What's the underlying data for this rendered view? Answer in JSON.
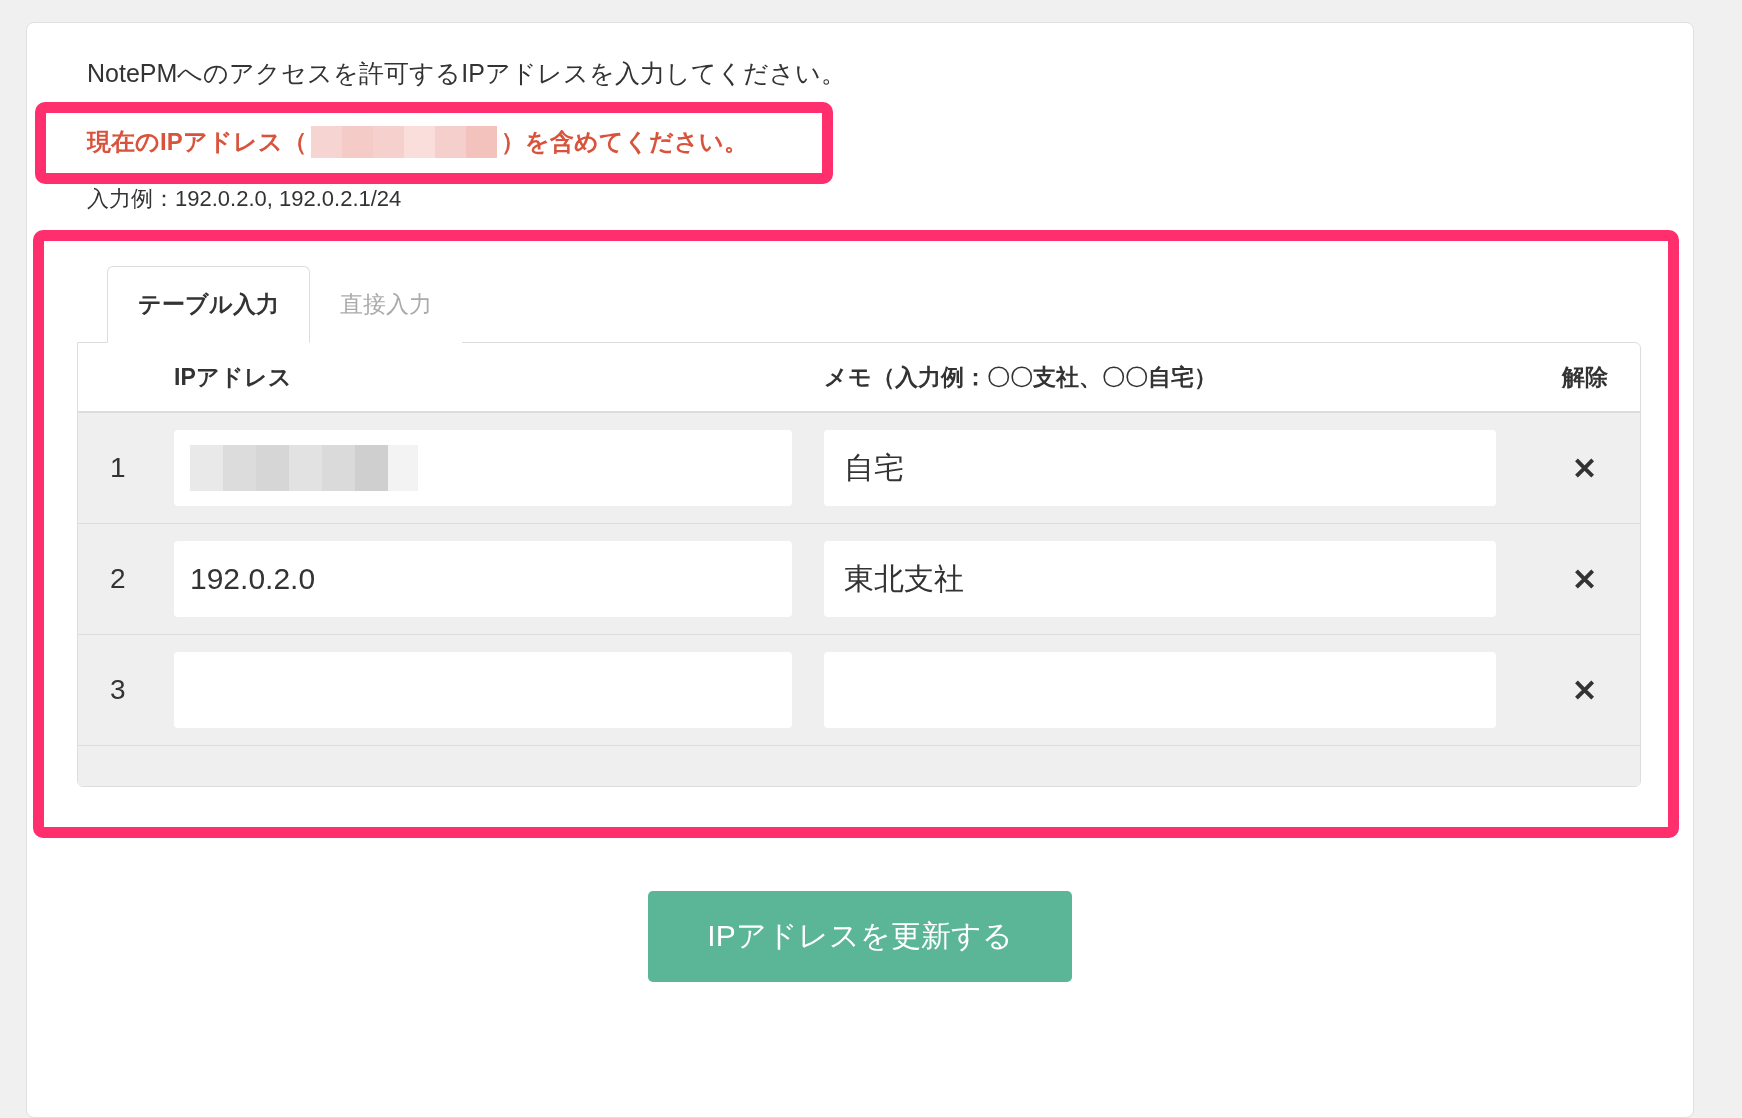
{
  "intro": "NotePMへのアクセスを許可するIPアドレスを入力してください。",
  "notice": {
    "before": "現在のIPアドレス（",
    "after": "）を含めてください。"
  },
  "example": "入力例：192.0.2.0, 192.0.2.1/24",
  "tabs": [
    {
      "label": "テーブル入力",
      "selected": true
    },
    {
      "label": "直接入力",
      "selected": false
    }
  ],
  "table": {
    "columns": [
      "IPアドレス",
      "メモ（入力例：〇〇支社、〇〇自宅）",
      "解除"
    ],
    "rows": [
      {
        "number": "1",
        "ip": "",
        "ip_redacted": true,
        "memo": "自宅",
        "remove": "✕"
      },
      {
        "number": "2",
        "ip": "192.0.2.0",
        "ip_redacted": false,
        "memo": "東北支社",
        "remove": "✕"
      },
      {
        "number": "3",
        "ip": "",
        "ip_redacted": false,
        "memo": "",
        "remove": "✕"
      }
    ]
  },
  "submit": "IPアドレスを更新する"
}
